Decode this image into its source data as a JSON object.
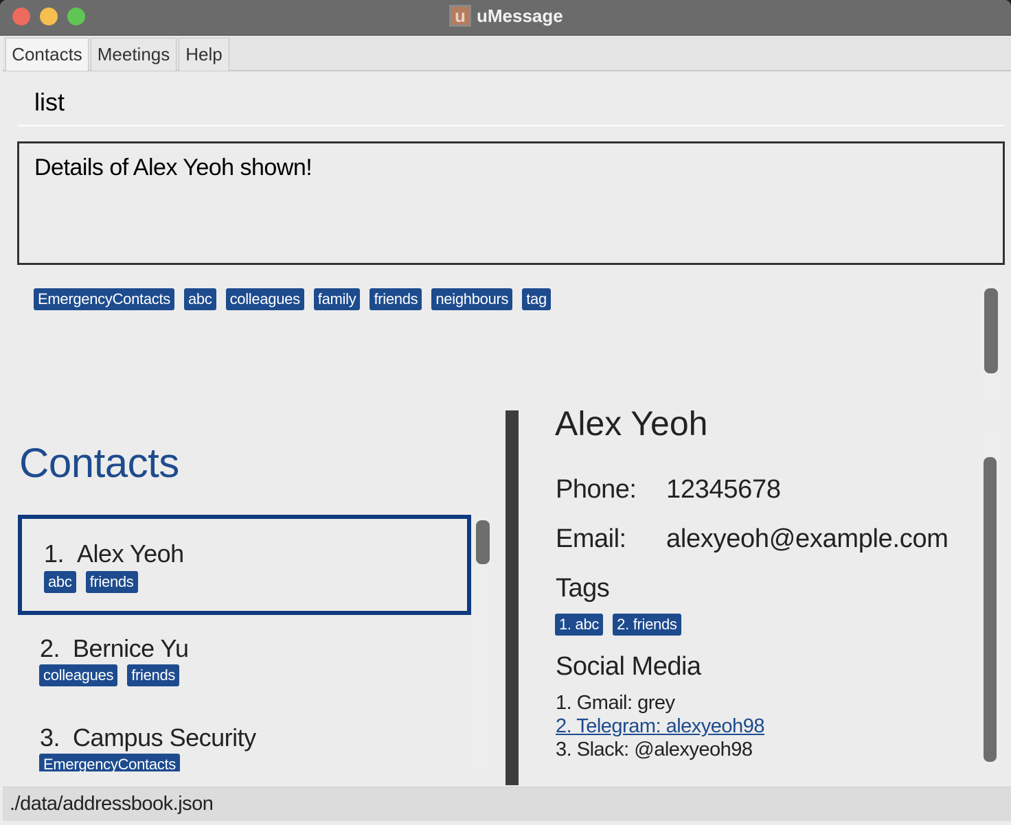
{
  "window": {
    "title": "uMessage",
    "app_icon_letter": "u"
  },
  "menu": {
    "items": [
      {
        "label": "Contacts"
      },
      {
        "label": "Meetings"
      },
      {
        "label": "Help"
      }
    ]
  },
  "command": {
    "value": "list"
  },
  "result": {
    "text": "Details of Alex Yeoh shown!"
  },
  "tag_bar": {
    "tags": [
      "EmergencyContacts",
      "abc",
      "colleagues",
      "family",
      "friends",
      "neighbours",
      "tag"
    ]
  },
  "contacts": {
    "heading": "Contacts",
    "list": [
      {
        "index": "1.",
        "name": "Alex Yeoh",
        "tags": [
          "abc",
          "friends"
        ]
      },
      {
        "index": "2.",
        "name": "Bernice Yu",
        "tags": [
          "colleagues",
          "friends"
        ]
      },
      {
        "index": "3.",
        "name": "Campus Security",
        "tags": [
          "EmergencyContacts"
        ]
      }
    ]
  },
  "detail": {
    "name": "Alex Yeoh",
    "phone_label": "Phone:",
    "phone": "12345678",
    "email_label": "Email:",
    "email": "alexyeoh@example.com",
    "tags_heading": "Tags",
    "tags": [
      "1. abc",
      "2. friends"
    ],
    "social_heading": "Social Media",
    "social": [
      "1. Gmail: grey",
      "2. Telegram: alexyeoh98",
      "3. Slack: @alexyeoh98"
    ]
  },
  "status": {
    "path": "./data/addressbook.json"
  },
  "colors": {
    "accent": "#1d4b8e",
    "selected_border": "#0f3a80",
    "titlebar": "#6b6b6b"
  }
}
